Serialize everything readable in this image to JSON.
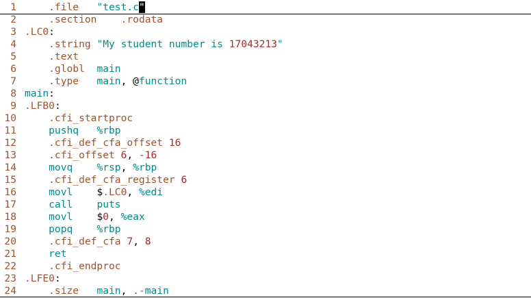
{
  "lines": [
    {
      "n": "1",
      "segs": [
        [
          "dir",
          "    .file"
        ],
        [
          "plain",
          "   "
        ],
        [
          "str",
          "\"test.c"
        ],
        [
          "cur",
          "\""
        ]
      ]
    },
    {
      "n": "2",
      "segs": [
        [
          "dir",
          "    .section"
        ],
        [
          "plain",
          "    "
        ],
        [
          "dir",
          ".rodata"
        ]
      ]
    },
    {
      "n": "3",
      "segs": [
        [
          "lab",
          ".LC0"
        ],
        [
          "plain",
          ":"
        ]
      ]
    },
    {
      "n": "4",
      "segs": [
        [
          "dir",
          "    .string"
        ],
        [
          "plain",
          " "
        ],
        [
          "str",
          "\"My student number is "
        ],
        [
          "num",
          "17043213"
        ],
        [
          "str",
          "\""
        ]
      ]
    },
    {
      "n": "5",
      "segs": [
        [
          "dir",
          "    .text"
        ]
      ]
    },
    {
      "n": "6",
      "segs": [
        [
          "dir",
          "    .globl"
        ],
        [
          "plain",
          "  "
        ],
        [
          "ins",
          "main"
        ]
      ]
    },
    {
      "n": "7",
      "segs": [
        [
          "dir",
          "    .type"
        ],
        [
          "plain",
          "   "
        ],
        [
          "ins",
          "main"
        ],
        [
          "plain",
          ", @"
        ],
        [
          "ins",
          "function"
        ]
      ]
    },
    {
      "n": "8",
      "segs": [
        [
          "ins",
          "main"
        ],
        [
          "plain",
          ":"
        ]
      ]
    },
    {
      "n": "9",
      "segs": [
        [
          "lab",
          ".LFB0"
        ],
        [
          "plain",
          ":"
        ]
      ]
    },
    {
      "n": "10",
      "segs": [
        [
          "dir",
          "    .cfi_startproc"
        ]
      ]
    },
    {
      "n": "11",
      "segs": [
        [
          "ins",
          "    pushq"
        ],
        [
          "plain",
          "   "
        ],
        [
          "reg",
          "%rbp"
        ]
      ]
    },
    {
      "n": "12",
      "segs": [
        [
          "dir",
          "    .cfi_def_cfa_offset"
        ],
        [
          "plain",
          " "
        ],
        [
          "num",
          "16"
        ]
      ]
    },
    {
      "n": "13",
      "segs": [
        [
          "dir",
          "    .cfi_offset"
        ],
        [
          "plain",
          " "
        ],
        [
          "num",
          "6"
        ],
        [
          "plain",
          ", "
        ],
        [
          "num",
          "-16"
        ]
      ]
    },
    {
      "n": "14",
      "segs": [
        [
          "ins",
          "    movq"
        ],
        [
          "plain",
          "    "
        ],
        [
          "reg",
          "%rsp"
        ],
        [
          "plain",
          ", "
        ],
        [
          "reg",
          "%rbp"
        ]
      ]
    },
    {
      "n": "15",
      "segs": [
        [
          "dir",
          "    .cfi_def_cfa_register"
        ],
        [
          "plain",
          " "
        ],
        [
          "num",
          "6"
        ]
      ]
    },
    {
      "n": "16",
      "segs": [
        [
          "ins",
          "    movl"
        ],
        [
          "plain",
          "    $"
        ],
        [
          "lab",
          ".LC0"
        ],
        [
          "plain",
          ", "
        ],
        [
          "reg",
          "%edi"
        ]
      ]
    },
    {
      "n": "17",
      "segs": [
        [
          "ins",
          "    call"
        ],
        [
          "plain",
          "    "
        ],
        [
          "ins",
          "puts"
        ]
      ]
    },
    {
      "n": "18",
      "segs": [
        [
          "ins",
          "    movl"
        ],
        [
          "plain",
          "    $"
        ],
        [
          "num",
          "0"
        ],
        [
          "plain",
          ", "
        ],
        [
          "reg",
          "%eax"
        ]
      ]
    },
    {
      "n": "19",
      "segs": [
        [
          "ins",
          "    popq"
        ],
        [
          "plain",
          "    "
        ],
        [
          "reg",
          "%rbp"
        ]
      ]
    },
    {
      "n": "20",
      "segs": [
        [
          "dir",
          "    .cfi_def_cfa"
        ],
        [
          "plain",
          " "
        ],
        [
          "num",
          "7"
        ],
        [
          "plain",
          ", "
        ],
        [
          "num",
          "8"
        ]
      ]
    },
    {
      "n": "21",
      "segs": [
        [
          "ins",
          "    ret"
        ]
      ]
    },
    {
      "n": "22",
      "segs": [
        [
          "dir",
          "    .cfi_endproc"
        ]
      ]
    },
    {
      "n": "23",
      "segs": [
        [
          "lab",
          ".LFE0"
        ],
        [
          "plain",
          ":"
        ]
      ]
    },
    {
      "n": "24",
      "segs": [
        [
          "dir",
          "    .size"
        ],
        [
          "plain",
          "   "
        ],
        [
          "ins",
          "main"
        ],
        [
          "plain",
          ", "
        ],
        [
          "dir",
          ".-"
        ],
        [
          "ins",
          "main"
        ]
      ]
    }
  ]
}
